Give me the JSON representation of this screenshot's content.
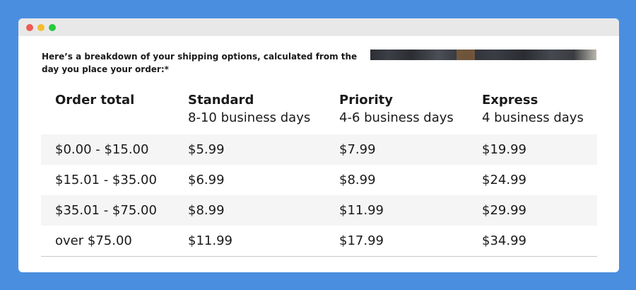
{
  "window": {
    "controls": [
      "close",
      "minimize",
      "maximize"
    ]
  },
  "intro": {
    "text": "Here’s a breakdown of your shipping options, calculated from the day you place your order:*"
  },
  "table": {
    "headers": [
      {
        "name": "Order total",
        "sub": ""
      },
      {
        "name": "Standard",
        "sub": "8-10 business days"
      },
      {
        "name": "Priority",
        "sub": "4-6 business days"
      },
      {
        "name": "Express",
        "sub": "4 business days"
      }
    ],
    "rows": [
      [
        "$0.00 - $15.00",
        "$5.99",
        "$7.99",
        "$19.99"
      ],
      [
        "$15.01 - $35.00",
        "$6.99",
        "$8.99",
        "$24.99"
      ],
      [
        "$35.01 - $75.00",
        "$8.99",
        "$11.99",
        "$29.99"
      ],
      [
        "over $75.00",
        "$11.99",
        "$17.99",
        "$34.99"
      ]
    ]
  },
  "colors": {
    "background": "#4a8ee0",
    "row_shade": "#f5f5f5",
    "text": "#1a1a1a"
  }
}
